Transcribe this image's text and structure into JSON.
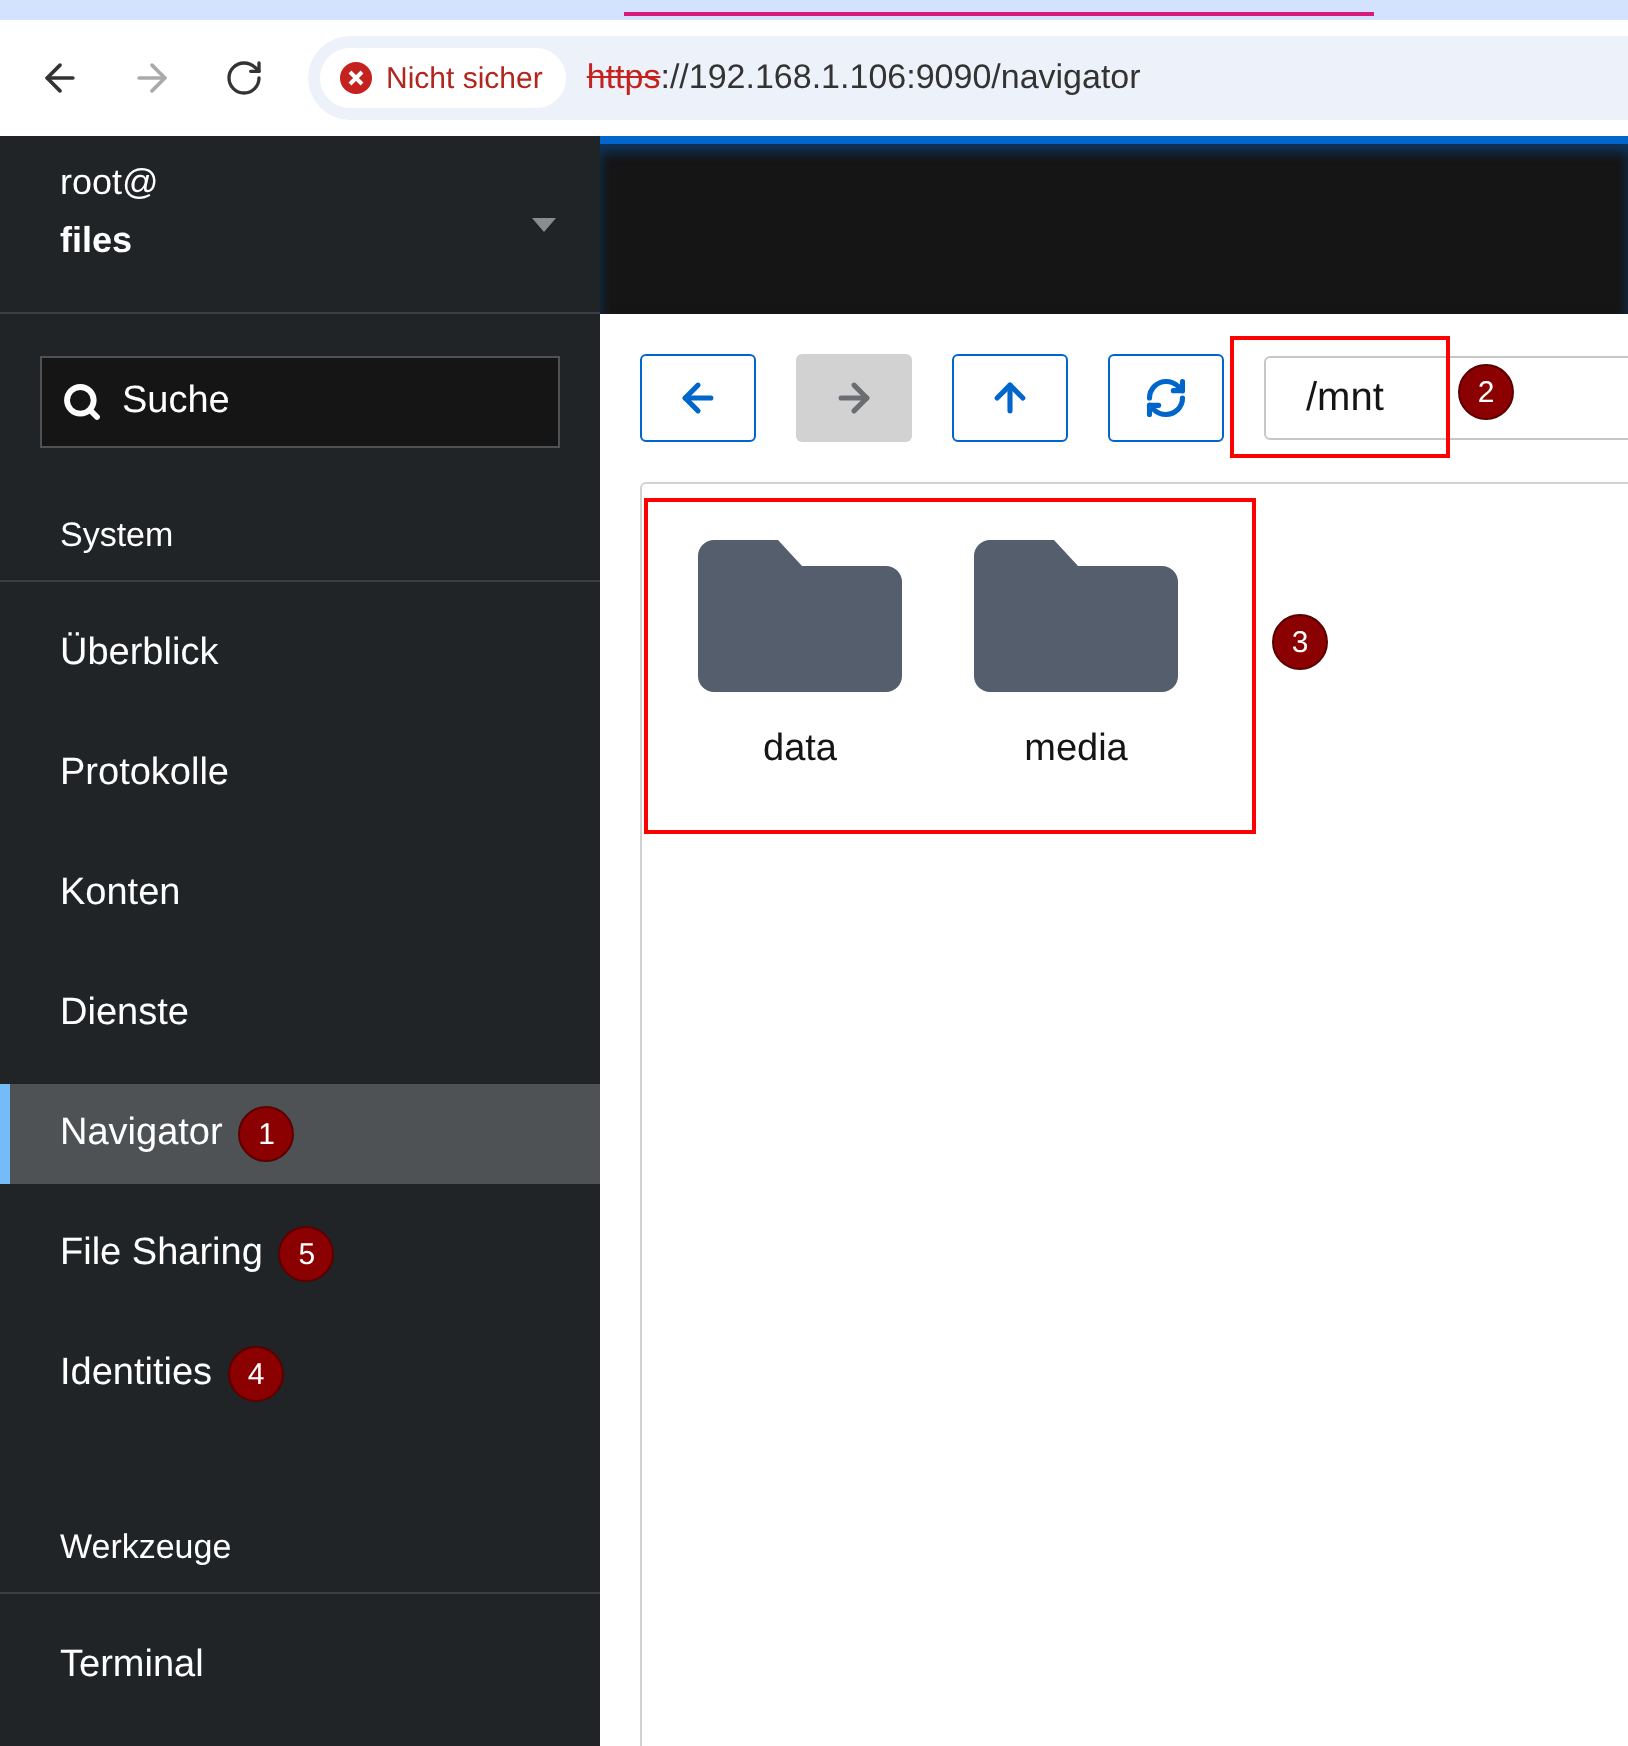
{
  "browser": {
    "nav_buttons": [
      {
        "kind": "back",
        "disabled": false
      },
      {
        "kind": "forward",
        "disabled": true
      },
      {
        "kind": "reload",
        "disabled": false
      }
    ],
    "security_chip": "Nicht sicher",
    "url": {
      "scheme": "https",
      "scheme_struck": true,
      "rest": "://192.168.1.106:9090/navigator"
    }
  },
  "host": {
    "user": "root@",
    "name": "files"
  },
  "sidebar": {
    "search": {
      "placeholder": "Suche"
    },
    "sections": [
      {
        "title": "System",
        "items": [
          {
            "label": "Überblick",
            "selected": false
          },
          {
            "label": "Protokolle",
            "selected": false
          },
          {
            "label": "Konten",
            "selected": false
          },
          {
            "label": "Dienste",
            "selected": false
          },
          {
            "label": "Navigator",
            "selected": true,
            "badge": "1"
          },
          {
            "label": "File Sharing",
            "selected": false,
            "badge": "5"
          },
          {
            "label": "Identities",
            "selected": false,
            "badge": "4"
          }
        ]
      },
      {
        "title": "Werkzeuge",
        "items": [
          {
            "label": "Terminal",
            "selected": false
          }
        ]
      }
    ]
  },
  "toolbar": {
    "buttons": [
      {
        "kind": "back",
        "disabled": false
      },
      {
        "kind": "forward",
        "disabled": true
      },
      {
        "kind": "up",
        "disabled": false
      },
      {
        "kind": "refresh",
        "disabled": false
      }
    ],
    "path": {
      "value": "/mnt",
      "highlighted": true,
      "badge": "2"
    }
  },
  "files": {
    "highlighted": true,
    "badge": "3",
    "items": [
      {
        "name": "data",
        "kind": "folder"
      },
      {
        "name": "media",
        "kind": "folder"
      }
    ]
  }
}
